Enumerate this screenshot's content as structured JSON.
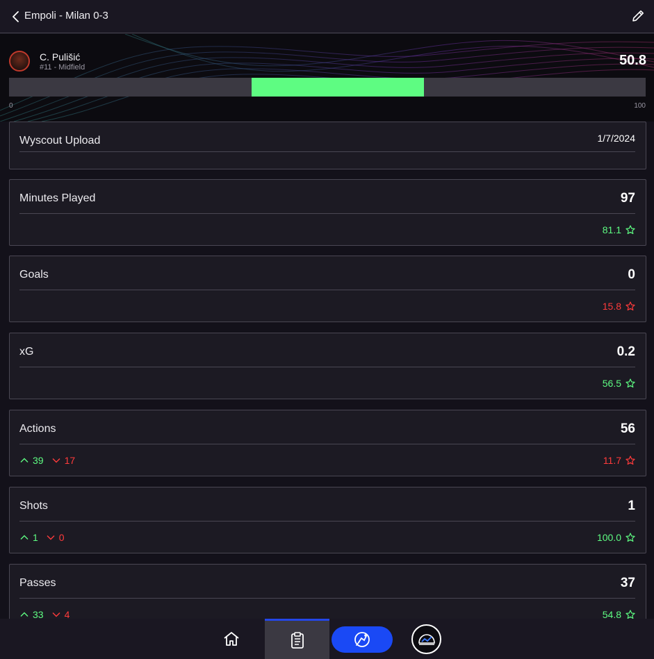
{
  "header": {
    "match_title": "Empoli - Milan 0-3"
  },
  "player": {
    "name": "C. Pulišić",
    "subtitle": "#11 - Midfield",
    "score": "50.8",
    "rating_bar": {
      "start_fraction": 0.381,
      "end_fraction": 0.652
    },
    "scale_min": "0",
    "scale_max": "100"
  },
  "upload": {
    "label": "Wyscout Upload",
    "date": "1/7/2024"
  },
  "stats": [
    {
      "label": "Minutes Played",
      "value": "97",
      "rating": "81.1",
      "rating_status": "good"
    },
    {
      "label": "Goals",
      "value": "0",
      "rating": "15.8",
      "rating_status": "bad"
    },
    {
      "label": "xG",
      "value": "0.2",
      "rating": "56.5",
      "rating_status": "good"
    },
    {
      "label": "Actions",
      "value": "56",
      "up": "39",
      "down": "17",
      "rating": "11.7",
      "rating_status": "bad"
    },
    {
      "label": "Shots",
      "value": "1",
      "up": "1",
      "down": "0",
      "rating": "100.0",
      "rating_status": "good"
    },
    {
      "label": "Passes",
      "value": "37",
      "up": "33",
      "down": "4",
      "rating": "54.8",
      "rating_status": "good"
    }
  ],
  "nav": {
    "items": [
      "home-icon",
      "clipboard-icon",
      "training-icon",
      "club-logo"
    ],
    "active": "clipboard-icon"
  },
  "colors": {
    "accent_green": "#5efc82",
    "accent_red": "#ff3b3b",
    "nav_blue": "#1a49f5"
  }
}
